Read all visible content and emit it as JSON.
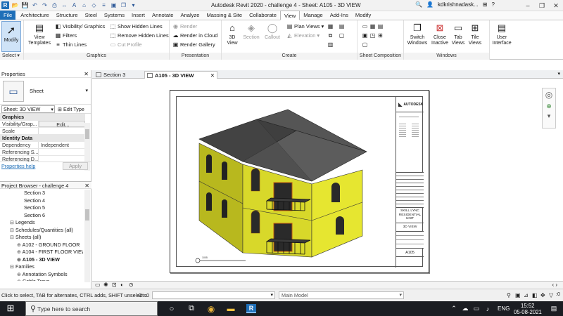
{
  "window": {
    "title": "Autodesk Revit 2020 - challenge 4 - Sheet: A105 - 3D VIEW",
    "user": "kdkrishnadask...",
    "controls": [
      "–",
      "❐",
      "✕"
    ]
  },
  "ribbon_tabs": [
    "File",
    "Architecture",
    "Structure",
    "Steel",
    "Systems",
    "Insert",
    "Annotate",
    "Analyze",
    "Massing & Site",
    "Collaborate",
    "View",
    "Manage",
    "Add-Ins",
    "Modify"
  ],
  "active_tab": "View",
  "ribbon": {
    "select": {
      "modify": "Modify",
      "panel": "Select ▾"
    },
    "graphics": {
      "view_templates": "View\nTemplates",
      "visibility": "Visibility/ Graphics",
      "filters": "Filters",
      "thin_lines": "Thin Lines",
      "show_hidden": "Show  Hidden Lines",
      "remove_hidden": "Remove  Hidden Lines",
      "cut_profile": "Cut  Profile",
      "panel": "Graphics"
    },
    "presentation": {
      "render": "Render",
      "render_cloud": "Render  in Cloud",
      "render_gallery": "Render  Gallery",
      "panel": "Presentation"
    },
    "create": {
      "view3d": "3D\nView",
      "section": "Section",
      "callout": "Callout",
      "plan_views": "Plan  Views",
      "elevation": "Elevation",
      "panel": "Create"
    },
    "sheet_composition": {
      "panel": "Sheet Composition"
    },
    "windows": {
      "switch": "Switch\nWindows",
      "close_inactive": "Close\nInactive",
      "tab_views": "Tab\nViews",
      "tile_views": "Tile\nViews",
      "user_interface": "User\nInterface",
      "panel": "Windows"
    }
  },
  "properties": {
    "header": "Properties",
    "type_name": "Sheet",
    "instance": "Sheet: 3D VIEW",
    "edit_type": "Edit Type",
    "groups": [
      {
        "name": "Graphics",
        "rows": [
          {
            "k": "Visibility/Grap...",
            "v": "Edit..."
          },
          {
            "k": "Scale",
            "v": ""
          }
        ]
      },
      {
        "name": "Identity Data",
        "rows": [
          {
            "k": "Dependency",
            "v": "Independent"
          },
          {
            "k": "Referencing S...",
            "v": ""
          },
          {
            "k": "Referencing D...",
            "v": ""
          }
        ]
      }
    ],
    "help": "Properties help",
    "apply": "Apply"
  },
  "project_browser": {
    "header": "Project Browser - challenge 4",
    "items": [
      {
        "label": "Section 3",
        "indent": 3,
        "bold": false
      },
      {
        "label": "Section 4",
        "indent": 3,
        "bold": false
      },
      {
        "label": "Section 5",
        "indent": 3,
        "bold": false
      },
      {
        "label": "Section 6",
        "indent": 3,
        "bold": false
      },
      {
        "label": "Legends",
        "indent": 1,
        "bold": false
      },
      {
        "label": "Schedules/Quantities (all)",
        "indent": 1,
        "bold": false
      },
      {
        "label": "Sheets (all)",
        "indent": 1,
        "bold": false
      },
      {
        "label": "A102 - GROUND FLOOR",
        "indent": 2,
        "bold": false
      },
      {
        "label": "A104 - FIRST FLOOR VIEW",
        "indent": 2,
        "bold": false
      },
      {
        "label": "A105 - 3D VIEW",
        "indent": 2,
        "bold": true
      },
      {
        "label": "Families",
        "indent": 1,
        "bold": false
      },
      {
        "label": "Annotation Symbols",
        "indent": 2,
        "bold": false
      },
      {
        "label": "Cable Trays",
        "indent": 2,
        "bold": false
      }
    ]
  },
  "doc_tabs": [
    {
      "label": "Section 3",
      "active": false
    },
    {
      "label": "A105 - 3D VIEW",
      "active": true
    }
  ],
  "sheet": {
    "logo": "AUTODESK",
    "project": "SKILL LYNC\nRESIDENTIAL\nUNIT",
    "view_name": "3D VIEW",
    "number": "A105",
    "scale_label": "1005"
  },
  "status": {
    "message": "Click to select, TAB for alternates, CTRL adds, SHIFT unselects.",
    "model": "Main Model",
    "zero": ":0"
  },
  "taskbar": {
    "search_placeholder": "Type here to search",
    "lang": "ENG",
    "time": "15:52",
    "date": "05-08-2021"
  },
  "colors": {
    "accent": "#1f6fb8",
    "wall": "#d6d62a",
    "roof": "#4a4a4a"
  }
}
